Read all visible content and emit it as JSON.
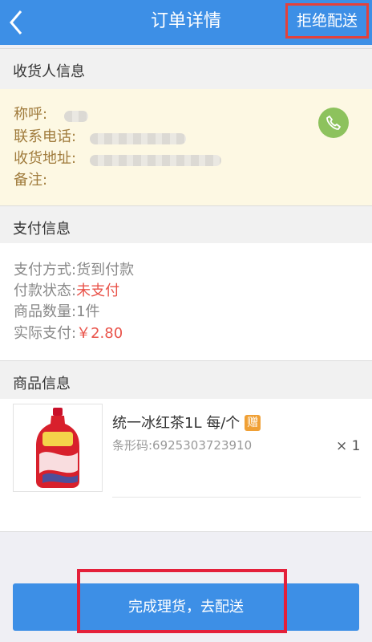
{
  "header": {
    "title": "订单详情",
    "reject_label": "拒绝配送"
  },
  "receiver": {
    "heading": "收货人信息",
    "name_label": "称呼:",
    "phone_label": "联系电话:",
    "address_label": "收货地址:",
    "note_label": "备注:"
  },
  "payment": {
    "heading": "支付信息",
    "method_label": "支付方式:",
    "method_value": "货到付款",
    "status_label": "付款状态:",
    "status_value": "未支付",
    "count_label": "商品数量:",
    "count_value": "1件",
    "paid_label": "实际支付:",
    "paid_value": "￥2.80"
  },
  "goods": {
    "heading": "商品信息",
    "items": [
      {
        "name": "统一冰红茶1L 每/个",
        "gift_badge": "赠",
        "barcode": "条形码:6925303723910",
        "quantity": "× 1"
      }
    ]
  },
  "footer": {
    "action_label": "完成理货，去配送"
  },
  "colors": {
    "primary": "#3d8fe6",
    "accent_red": "#e9534a",
    "phone_green": "#8dc25d",
    "gift_orange": "#f0a035"
  }
}
